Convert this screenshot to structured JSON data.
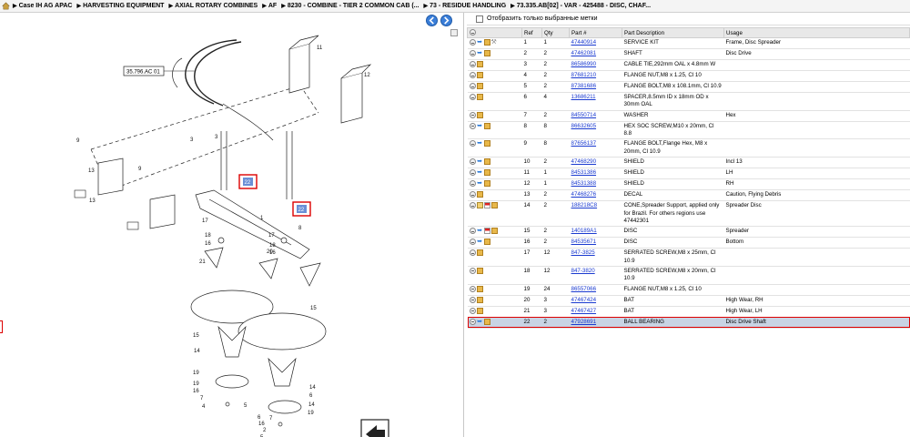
{
  "breadcrumb": {
    "items": [
      "Case IH AG APAC",
      "HARVESTING EQUIPMENT",
      "AXIAL ROTARY COMBINES",
      "AF",
      "8230 - COMBINE - TIER 2 COMMON CAB (...",
      "73 - RESIDUE HANDLING",
      "73.335.AB[02] - VAR - 425488 - DISC, CHAF..."
    ]
  },
  "diagram": {
    "ref_label": "35.796.AC 01",
    "callouts": [
      "11",
      "12",
      "9",
      "3",
      "13",
      "10",
      "9",
      "13",
      "10",
      "22",
      "22",
      "1",
      "8",
      "17",
      "18",
      "16",
      "21",
      "20",
      "17",
      "18",
      "16",
      "19",
      "15",
      "15",
      "14",
      "14",
      "19",
      "16",
      "7",
      "4",
      "5",
      "6",
      "14",
      "19",
      "16",
      "2",
      "5",
      "6",
      "3",
      "7"
    ],
    "highlight_label": "22"
  },
  "right": {
    "filter_label": "Отобразить только выбранные метки",
    "columns": [
      "",
      "Ref",
      "Qty",
      "Part #",
      "Part Description",
      "Usage"
    ]
  },
  "parts": [
    {
      "ref": "1",
      "qty": "1",
      "part": "47440914",
      "desc": "SERVICE KIT",
      "usage": "Frame, Disc Spreader",
      "icons": [
        "plus",
        "arrow",
        "box",
        "tool"
      ]
    },
    {
      "ref": "2",
      "qty": "2",
      "part": "47462081",
      "desc": "SHAFT",
      "usage": "Disc Drive",
      "icons": [
        "plus",
        "arrow",
        "box"
      ]
    },
    {
      "ref": "3",
      "qty": "2",
      "part": "86586990",
      "desc": "CABLE TIE,292mm OAL x 4.8mm W",
      "usage": "",
      "icons": [
        "plus",
        "box"
      ]
    },
    {
      "ref": "4",
      "qty": "2",
      "part": "87681210",
      "desc": "FLANGE NUT,M8 x 1.25, Cl 10",
      "usage": "",
      "icons": [
        "plus",
        "box"
      ]
    },
    {
      "ref": "5",
      "qty": "2",
      "part": "87381686",
      "desc": "FLANGE BOLT,M8 x 108.1mm, Cl 10.9",
      "usage": "",
      "icons": [
        "plus",
        "box"
      ]
    },
    {
      "ref": "6",
      "qty": "4",
      "part": "13686211",
      "desc": "SPACER,8.5mm ID x 18mm OD x 30mm OAL",
      "usage": "",
      "icons": [
        "plus",
        "box"
      ]
    },
    {
      "ref": "7",
      "qty": "2",
      "part": "84550714",
      "desc": "WASHER",
      "usage": "Hex",
      "icons": [
        "plus",
        "box"
      ]
    },
    {
      "ref": "8",
      "qty": "8",
      "part": "86632605",
      "desc": "HEX SOC SCREW,M10 x 20mm, Cl 8.8",
      "usage": "",
      "icons": [
        "plus",
        "arrow",
        "box"
      ]
    },
    {
      "ref": "9",
      "qty": "8",
      "part": "87656137",
      "desc": "FLANGE BOLT,Flange Hex, M8 x 20mm, Cl 10.9",
      "usage": "",
      "icons": [
        "plus",
        "arrow",
        "box"
      ]
    },
    {
      "ref": "10",
      "qty": "2",
      "part": "47468290",
      "desc": "SHIELD",
      "usage": "Incl 13",
      "icons": [
        "plus",
        "arrow",
        "box"
      ]
    },
    {
      "ref": "11",
      "qty": "1",
      "part": "84531386",
      "desc": "SHIELD",
      "usage": "LH",
      "icons": [
        "plus",
        "arrow",
        "box"
      ]
    },
    {
      "ref": "12",
      "qty": "1",
      "part": "84531388",
      "desc": "SHIELD",
      "usage": "RH",
      "icons": [
        "plus",
        "arrow",
        "box"
      ]
    },
    {
      "ref": "13",
      "qty": "2",
      "part": "47468276",
      "desc": "DECAL",
      "usage": "Caution, Flying Debris",
      "icons": [
        "plus",
        "box"
      ]
    },
    {
      "ref": "14",
      "qty": "2",
      "part": "188218C8",
      "desc": "CONE,Spreader Support, applied only for Brazil. For others regions use 47442301",
      "usage": "Spreader Disc",
      "icons": [
        "plus",
        "doc",
        "flag",
        "box"
      ]
    },
    {
      "ref": "15",
      "qty": "2",
      "part": "140189A1",
      "desc": "DISC",
      "usage": "Spreader",
      "icons": [
        "plus",
        "arrow",
        "flag",
        "box"
      ]
    },
    {
      "ref": "16",
      "qty": "2",
      "part": "84535671",
      "desc": "DISC",
      "usage": "Bottom",
      "icons": [
        "plus",
        "arrow",
        "box"
      ]
    },
    {
      "ref": "17",
      "qty": "12",
      "part": "847-3825",
      "desc": "SERRATED SCREW,M8 x 25mm, Cl 10.9",
      "usage": "",
      "icons": [
        "plus",
        "box"
      ]
    },
    {
      "ref": "18",
      "qty": "12",
      "part": "847-3820",
      "desc": "SERRATED SCREW,M8 x 20mm, Cl 10.9",
      "usage": "",
      "icons": [
        "plus",
        "box"
      ]
    },
    {
      "ref": "19",
      "qty": "24",
      "part": "86557066",
      "desc": "FLANGE NUT,M8 x 1.25, Cl 10",
      "usage": "",
      "icons": [
        "plus",
        "box"
      ]
    },
    {
      "ref": "20",
      "qty": "3",
      "part": "47467424",
      "desc": "BAT",
      "usage": "High Wear, RH",
      "icons": [
        "plus",
        "box"
      ]
    },
    {
      "ref": "21",
      "qty": "3",
      "part": "47467427",
      "desc": "BAT",
      "usage": "High Wear, LH",
      "icons": [
        "plus",
        "box"
      ]
    },
    {
      "ref": "22",
      "qty": "2",
      "part": "47928691",
      "desc": "BALL BEARING",
      "usage": "Disc Drive Shaft",
      "icons": [
        "plus",
        "arrow",
        "box"
      ],
      "selected": true
    }
  ]
}
